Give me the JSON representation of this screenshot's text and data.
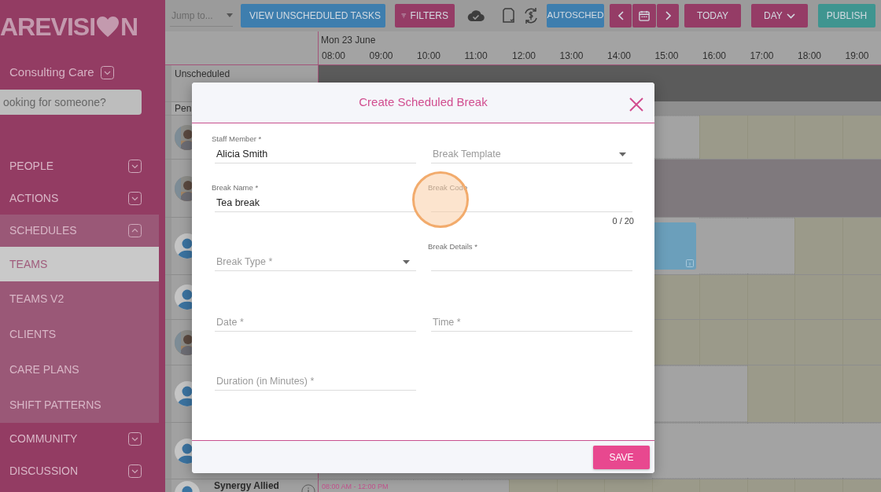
{
  "sidebar": {
    "logo": {
      "before": "AREVISI",
      "after": "N"
    },
    "organisation": "Consulting Care",
    "search": {
      "placeholder": "ooking for someone?"
    },
    "items": [
      {
        "label": "PEOPLE",
        "expanded": false
      },
      {
        "label": "ACTIONS",
        "expanded": false
      },
      {
        "label": "SCHEDULES",
        "expanded": true,
        "children": [
          {
            "label": "TEAMS",
            "selected": true
          },
          {
            "label": "TEAMS V2",
            "selected": false
          },
          {
            "label": "CLIENTS",
            "selected": false
          },
          {
            "label": "CARE PLANS",
            "selected": false
          },
          {
            "label": "SHIFT PATTERNS",
            "selected": false
          }
        ]
      },
      {
        "label": "COMMUNITY",
        "expanded": false
      },
      {
        "label": "DISCUSSION",
        "expanded": false
      }
    ]
  },
  "toolbar": [
    {
      "kind": "select",
      "placeholder": "Jump to..."
    },
    {
      "kind": "tasks",
      "label": "VIEW UNSCHEDULED TASKS"
    },
    {
      "kind": "filters",
      "label": "FILTERS"
    },
    {
      "kind": "cloud"
    },
    {
      "kind": "document"
    },
    {
      "kind": "currency"
    },
    {
      "kind": "autosched",
      "label": "AUTOSCHED"
    },
    {
      "kind": "pager"
    },
    {
      "kind": "today",
      "label": "TODAY"
    },
    {
      "kind": "view",
      "label": "DAY"
    },
    {
      "kind": "publish",
      "label": "PUBLISH"
    }
  ],
  "schedule": {
    "date": "Mon 23 June",
    "hours": [
      "08:00",
      "09:00",
      "10:00",
      "11:00",
      "12:00",
      "13:00",
      "14:00",
      "15:00",
      "16:00",
      "17:00",
      "18:00",
      "19:00"
    ],
    "rows": [
      {
        "kind": "unscheduled",
        "label": "Unscheduled"
      },
      {
        "kind": "group",
        "label": "Pen"
      },
      {
        "kind": "staff",
        "cells": [
          {
            "kind": "off"
          },
          {
            "kind": "open"
          },
          {
            "kind": "open"
          },
          {
            "kind": "open"
          },
          {
            "kind": "open"
          }
        ]
      },
      {
        "kind": "staff",
        "cells": [
          {
            "kind": "blocked"
          },
          {
            "kind": "blocked"
          },
          {
            "kind": "blocked"
          },
          {
            "kind": "blocked"
          },
          {
            "kind": "blocked"
          }
        ]
      },
      {
        "kind": "staff",
        "avatar": {
          "kind": "silhouette"
        },
        "cells": [
          {
            "kind": "shift"
          },
          {
            "kind": "off"
          },
          {
            "kind": "off"
          },
          {
            "kind": "open"
          },
          {
            "kind": "open"
          }
        ]
      },
      {
        "kind": "staff",
        "avatar": {
          "kind": "silhouette"
        },
        "cells": [
          {
            "kind": "open"
          },
          {
            "kind": "open"
          },
          {
            "kind": "open"
          },
          {
            "kind": "open"
          },
          {
            "kind": "open"
          }
        ]
      },
      {
        "kind": "staff",
        "cells": [
          {
            "kind": "open"
          },
          {
            "kind": "open"
          },
          {
            "kind": "open"
          },
          {
            "kind": "open"
          },
          {
            "kind": "open"
          }
        ]
      },
      {
        "kind": "staff",
        "avatar": {
          "kind": "silhouette"
        },
        "cells": [
          {
            "kind": "off"
          },
          {
            "kind": "off"
          },
          {
            "kind": "open"
          },
          {
            "kind": "open"
          },
          {
            "kind": "open"
          }
        ]
      },
      {
        "kind": "staff",
        "avatar": {
          "kind": "silhouette"
        },
        "cells": [
          {
            "kind": "off"
          },
          {
            "kind": "off"
          },
          {
            "kind": "off"
          },
          {
            "kind": "off"
          },
          {
            "kind": "off"
          }
        ]
      },
      {
        "kind": "staff",
        "avatar": {
          "kind": "silhouette"
        },
        "name": "Synergy Allied",
        "shift_time": "08:00 AM - 12:00 PM",
        "cells": [
          {
            "kind": "off"
          },
          {
            "kind": "off"
          },
          {
            "kind": "off"
          },
          {
            "kind": "off"
          },
          {
            "kind": "open"
          },
          {
            "kind": "open"
          },
          {
            "kind": "open"
          },
          {
            "kind": "open"
          },
          {
            "kind": "open"
          },
          {
            "kind": "open"
          },
          {
            "kind": "open"
          },
          {
            "kind": "open"
          }
        ]
      }
    ]
  },
  "dialog": {
    "title": "Create Scheduled Break",
    "fields": [
      {
        "kind": "text",
        "label": "Staff Member *",
        "value": "Alicia Smith"
      },
      {
        "kind": "select",
        "placeholder": "Break Template"
      },
      {
        "kind": "text",
        "label": "Break Name *",
        "value": "Tea break"
      },
      {
        "kind": "text",
        "label": "Break Code",
        "counter": "0 / 20"
      },
      {
        "kind": "select",
        "placeholder": "Break Type *"
      },
      {
        "kind": "text",
        "label": "Break Details *"
      },
      {
        "kind": "text",
        "placeholder": "Date *"
      },
      {
        "kind": "text",
        "placeholder": "Time *"
      },
      {
        "kind": "text",
        "placeholder": "Duration (in Minutes) *"
      }
    ],
    "save": "SAVE"
  }
}
